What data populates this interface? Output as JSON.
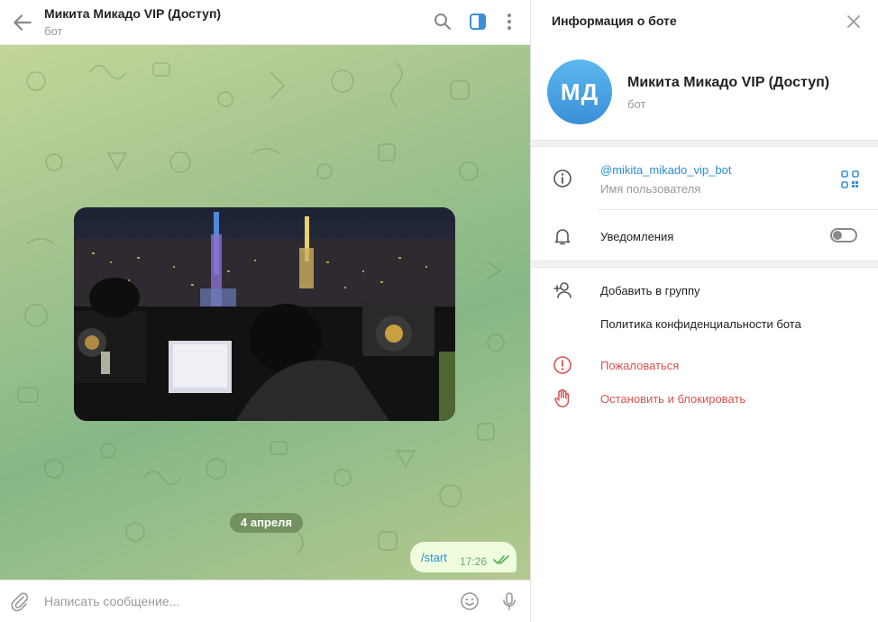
{
  "chat": {
    "title": "Микита Микадо VIP (Доступ)",
    "subtitle": "бот",
    "date_pill": "4 апреля",
    "outgoing_message": {
      "text": "/start",
      "time": "17:26",
      "status": "read"
    },
    "composer_placeholder": "Написать сообщение..."
  },
  "info_panel": {
    "title": "Информация о боте",
    "avatar_initials": "МД",
    "bot_name": "Микита Микадо VIP (Доступ)",
    "bot_sub": "бот",
    "username": "@mikita_mikado_vip_bot",
    "username_caption": "Имя пользователя",
    "notifications_label": "Уведомления",
    "notifications_enabled": false,
    "actions": [
      {
        "label": "Добавить в группу",
        "icon": "add-user-icon"
      },
      {
        "label": "Политика конфиденциальности бота",
        "icon": ""
      },
      {
        "label": "Пожаловаться",
        "icon": "report-icon"
      },
      {
        "label": "Остановить и блокировать",
        "icon": "block-hand-icon"
      }
    ]
  },
  "colors": {
    "accent": "#2a8fd4",
    "danger": "#d9534f",
    "avatar": "#4aa3e3",
    "outgoing_bubble": "#effdde",
    "chat_background": "#9fc28c"
  }
}
